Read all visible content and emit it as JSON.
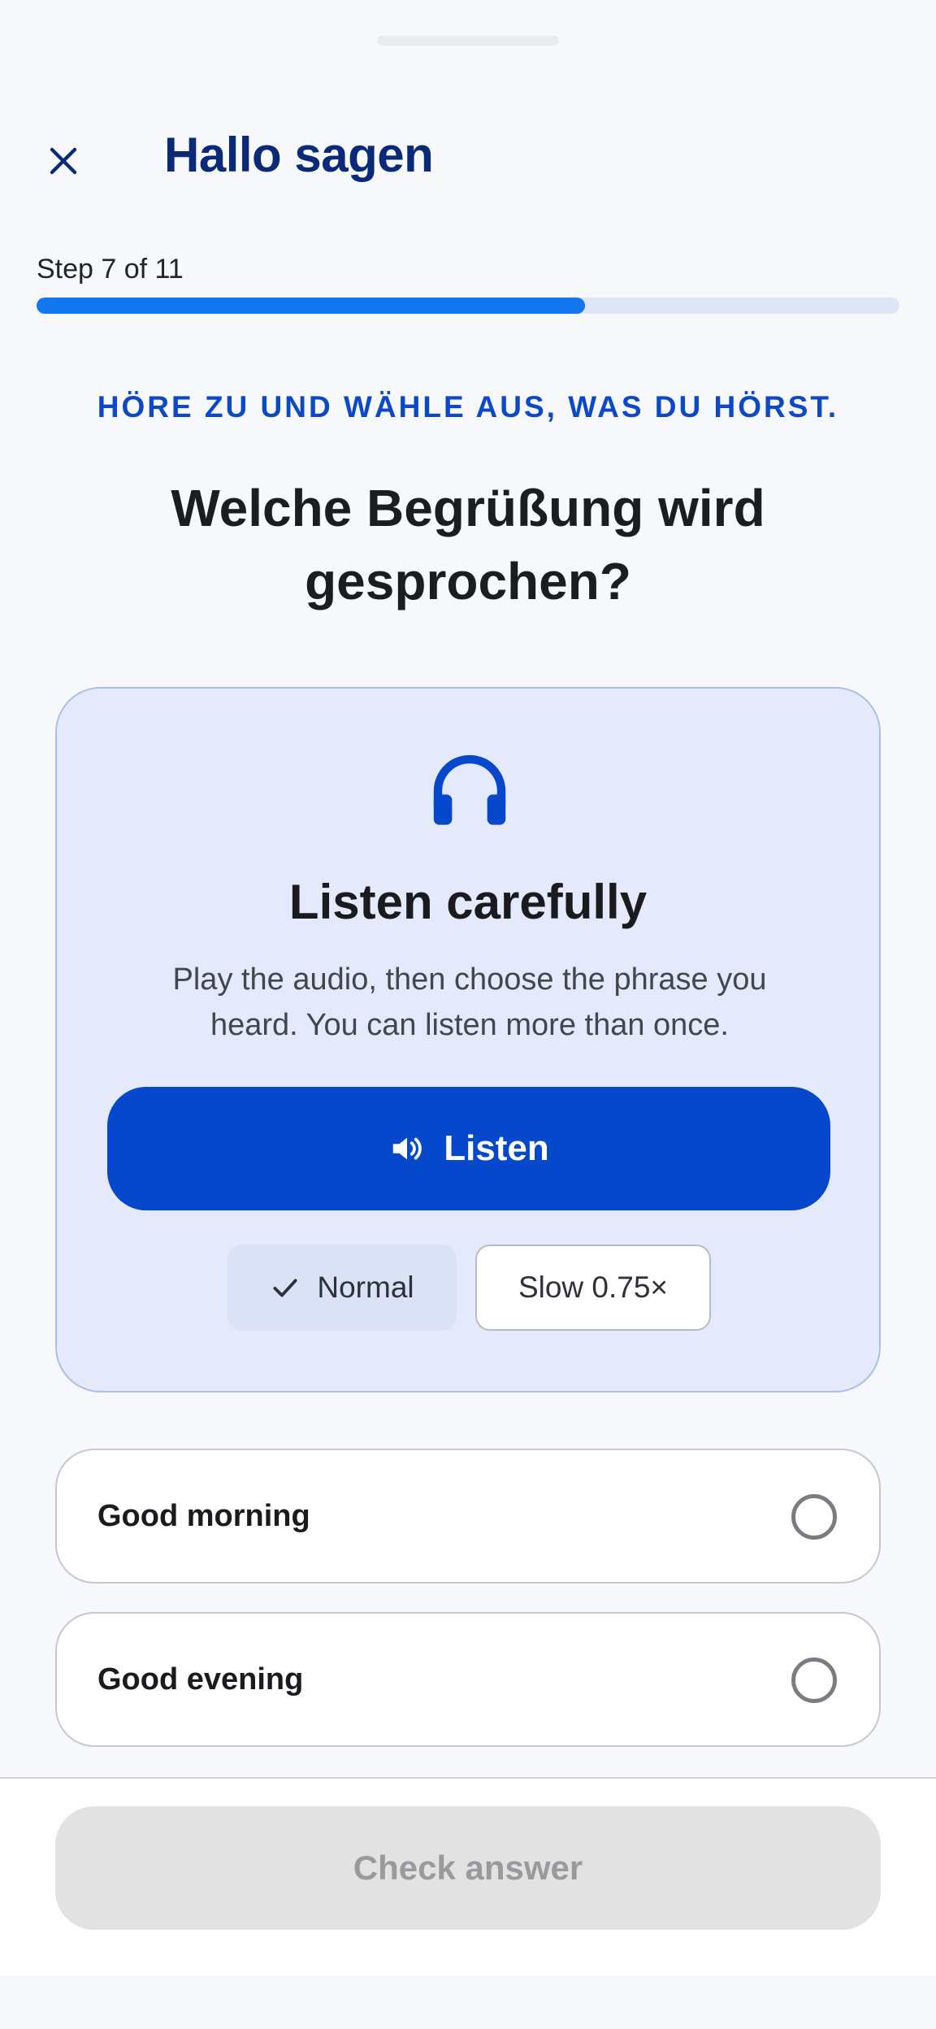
{
  "header": {
    "title": "Hallo sagen",
    "close_icon": "close-icon"
  },
  "progress": {
    "label": "Step 7 of 11",
    "current": 7,
    "total": 11,
    "fill_percent": 63.6
  },
  "exercise": {
    "instruction": "HÖRE ZU UND WÄHLE AUS, WAS DU HÖRST.",
    "question": "Welche Begrüßung wird gesprochen?"
  },
  "listen_card": {
    "icon": "headphones-icon",
    "title": "Listen carefully",
    "description": "Play the audio, then choose the phrase you heard. You can listen more than once.",
    "listen_button": {
      "label": "Listen",
      "icon": "speaker-icon"
    },
    "speeds": [
      {
        "label": "Normal",
        "selected": true,
        "icon": "check-icon"
      },
      {
        "label": "Slow 0.75×",
        "selected": false
      }
    ]
  },
  "options": [
    {
      "label": "Good morning",
      "selected": false
    },
    {
      "label": "Good evening",
      "selected": false
    }
  ],
  "footer": {
    "check_button": "Check answer",
    "check_enabled": false
  },
  "colors": {
    "brand_primary": "#0548cb",
    "title_navy": "#0a2a78",
    "progress_fill": "#1277ee",
    "progress_track": "#dde6f6",
    "card_bg": "#e4eafb",
    "disabled_bg": "#e2e2e2"
  }
}
